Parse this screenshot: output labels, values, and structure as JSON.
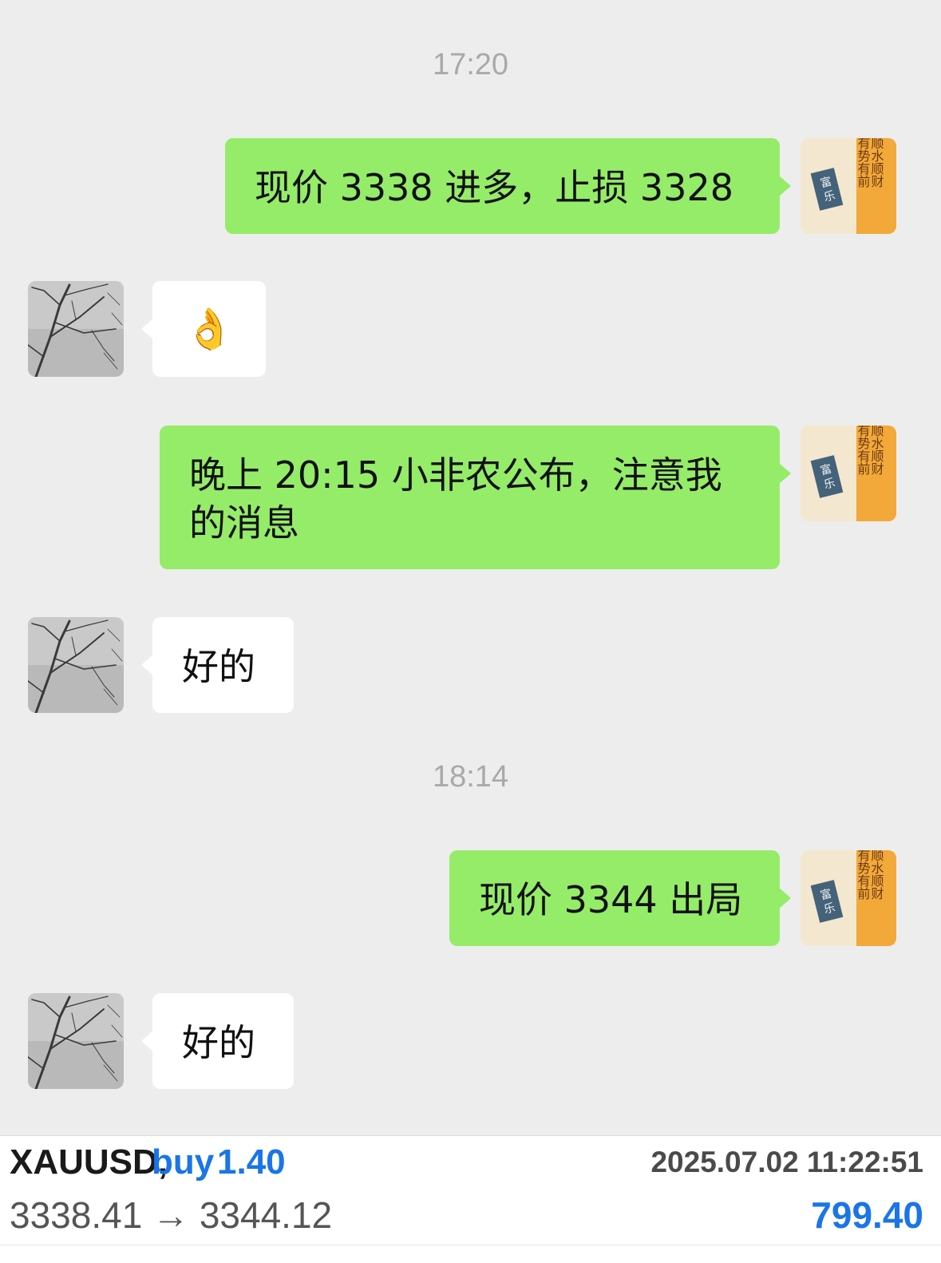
{
  "timestamps": [
    "17:20",
    "18:14"
  ],
  "messages": [
    {
      "side": "out",
      "text": "现价 3338 进多，止损 3328"
    },
    {
      "side": "in",
      "emoji": "👌"
    },
    {
      "side": "out",
      "line1": "晚上 20:15 小非农公布，注意我",
      "line2": "的消息"
    },
    {
      "side": "in",
      "text": "好的"
    },
    {
      "side": "out",
      "text": "现价 3344 出局"
    },
    {
      "side": "in",
      "text": "好的"
    }
  ],
  "avatar_self": {
    "calligraphy_cols": [
      "顺风顺水顺财",
      "有钱有势有前"
    ],
    "seal": "富乐"
  },
  "trade": {
    "symbol": "XAUUSD,",
    "side": "buy",
    "volume": "1.40",
    "datetime": "2025.07.02 11:22:51",
    "prices": "3338.41 → 3344.12",
    "profit": "799.40"
  },
  "colors": {
    "outgoing_bubble": "#95ec69",
    "incoming_bubble": "#ffffff",
    "background": "#ededed",
    "accent_blue": "#1a75e8"
  }
}
